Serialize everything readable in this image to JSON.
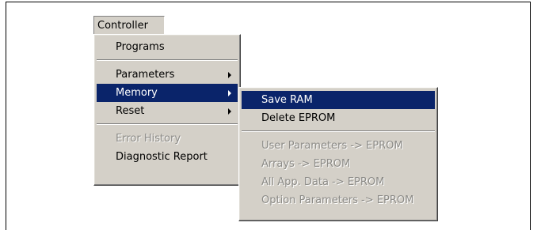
{
  "menubar": {
    "title": "Controller"
  },
  "controller_menu": {
    "programs": "Programs",
    "parameters": "Parameters",
    "memory": "Memory",
    "reset": "Reset",
    "error_history": "Error History",
    "diagnostic_report": "Diagnostic Report",
    "submenu_arrow_icon": "triangle-right-icon"
  },
  "memory_submenu": {
    "save_ram": "Save RAM",
    "delete_eprom": "Delete EPROM",
    "user_parameters_to_eprom": "User Parameters -> EPROM",
    "arrays_to_eprom": "Arrays -> EPROM",
    "all_app_data_to_eprom": "All App. Data -> EPROM",
    "option_parameters_to_eprom": "Option Parameters -> EPROM"
  },
  "colors": {
    "menu_background": "#d4d0c8",
    "highlight": "#0a246a",
    "highlight_text": "#ffffff",
    "disabled_text": "#8c8b87"
  }
}
